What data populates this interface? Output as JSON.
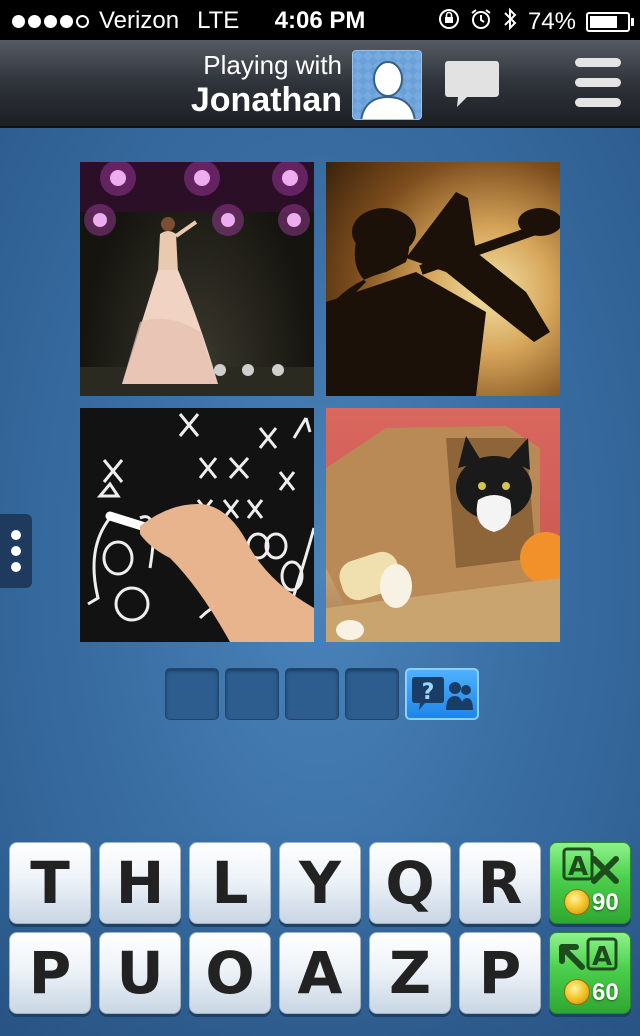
{
  "status_bar": {
    "carrier": "Verizon",
    "network": "LTE",
    "time": "4:06 PM",
    "battery": "74%",
    "battery_level": 0.74,
    "signal_bars_filled": 4,
    "icons": [
      "rotation-lock-icon",
      "alarm-icon",
      "bluetooth-icon",
      "battery-icon"
    ]
  },
  "header": {
    "playing_with_label": "Playing with",
    "opponent_name": "Jonathan",
    "avatar": "default-avatar",
    "chat_icon": "chat-bubble-icon",
    "menu_icon": "hamburger-menu-icon"
  },
  "puzzle": {
    "images": [
      "woman-on-stage",
      "saxophone-player-silhouette",
      "chalkboard-play-diagram",
      "cat-in-paper-bag"
    ],
    "answer_slots": [
      "",
      "",
      "",
      ""
    ],
    "ask_friends_icon": "question-friends-icon"
  },
  "keyboard": {
    "row1": [
      "T",
      "H",
      "L",
      "Y",
      "Q",
      "R"
    ],
    "row2": [
      "P",
      "U",
      "O",
      "A",
      "Z",
      "P"
    ],
    "remove_letters": {
      "icon": "remove-letter-icon",
      "letter": "A",
      "cost": "90"
    },
    "reveal_letter": {
      "icon": "reveal-letter-icon",
      "letter": "A",
      "cost": "60"
    }
  },
  "colors": {
    "background": "#3a6fa4",
    "key_face": "#eef3f8",
    "powerup_green": "#4bcf4b",
    "hint_blue": "#1e86e6"
  }
}
